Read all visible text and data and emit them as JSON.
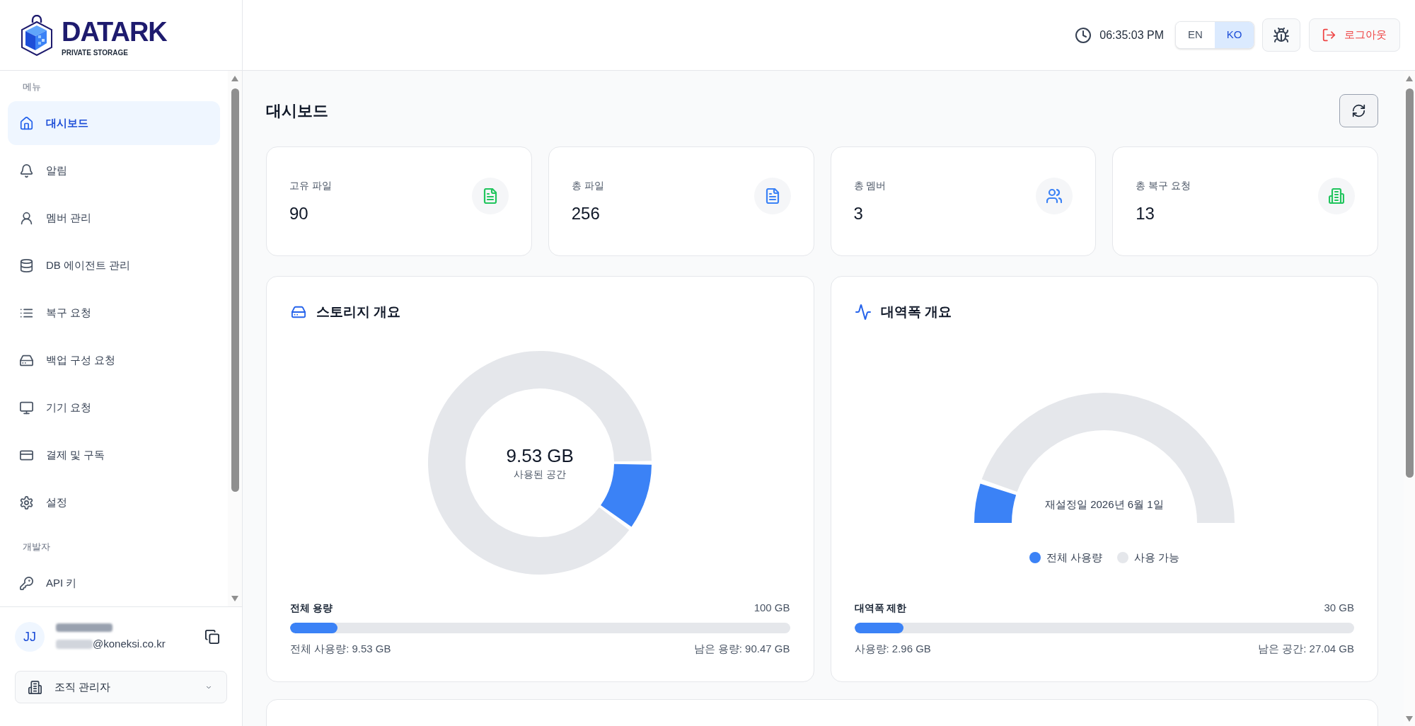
{
  "sidebar": {
    "logo": {
      "wordmark": "DATARK",
      "tagline": "PRIVATE STORAGE"
    },
    "sections": [
      {
        "heading": "메뉴",
        "items": [
          {
            "label": "대시보드",
            "selected": true
          },
          {
            "label": "알림",
            "selected": false
          },
          {
            "label": "멤버 관리",
            "selected": false
          },
          {
            "label": "DB 에이전트 관리",
            "selected": false
          },
          {
            "label": "복구 요청",
            "selected": false
          },
          {
            "label": "백업 구성 요청",
            "selected": false
          },
          {
            "label": "기기 요청",
            "selected": false
          },
          {
            "label": "결제 및 구독",
            "selected": false
          },
          {
            "label": "설정",
            "selected": false
          }
        ]
      },
      {
        "heading": "개발자",
        "items": [
          {
            "label": "API 키",
            "selected": false
          }
        ]
      }
    ],
    "user": {
      "initials": "JJ",
      "email": "@koneksi.co.kr"
    },
    "role_select": {
      "value": "조직 관리자"
    }
  },
  "header": {
    "time": "06:35:03 PM",
    "languages": [
      {
        "label": "EN",
        "selected": false
      },
      {
        "label": "KO",
        "selected": true
      }
    ],
    "logout_button": "로그아웃"
  },
  "page": {
    "title": "대시보드"
  },
  "stats": [
    {
      "label": "고유 파일",
      "value": "90",
      "color": "#22c55e"
    },
    {
      "label": "총 파일",
      "value": "256",
      "color": "#3b82f6"
    },
    {
      "label": "총 멤버",
      "value": "3",
      "color": "#3b82f6"
    },
    {
      "label": "총 복구 요청",
      "value": "13",
      "color": "#22c55e"
    }
  ],
  "storage": {
    "title": "스토리지 개요",
    "center_value": "9.53 GB",
    "center_label": "사용된 공간",
    "chart_data": {
      "type": "donut",
      "values": [
        9.53,
        90.47
      ],
      "colors": [
        "#3b82f6",
        "#e5e7eb"
      ]
    },
    "capacity_label": "전체 용량",
    "capacity_value": "100 GB",
    "level": 0.0953,
    "used": "전체 사용량: 9.53 GB",
    "remaining": "남은 용량: 90.47 GB"
  },
  "bandwidth": {
    "title": "대역폭 개요",
    "center_label": "재설정일 2026년 6월 1일",
    "chart_data": {
      "type": "donut",
      "categories": [
        "전체 사용량",
        "사용 가능"
      ],
      "values": [
        9.87,
        90.13
      ],
      "colors": [
        "#3b82f6",
        "#e5e7eb"
      ]
    },
    "limit_label": "대역폭 제한",
    "limit_value": "30 GB",
    "level": 0.0987,
    "used": "사용량: 2.96 GB",
    "remaining": "남은 공간: 27.04 GB"
  }
}
